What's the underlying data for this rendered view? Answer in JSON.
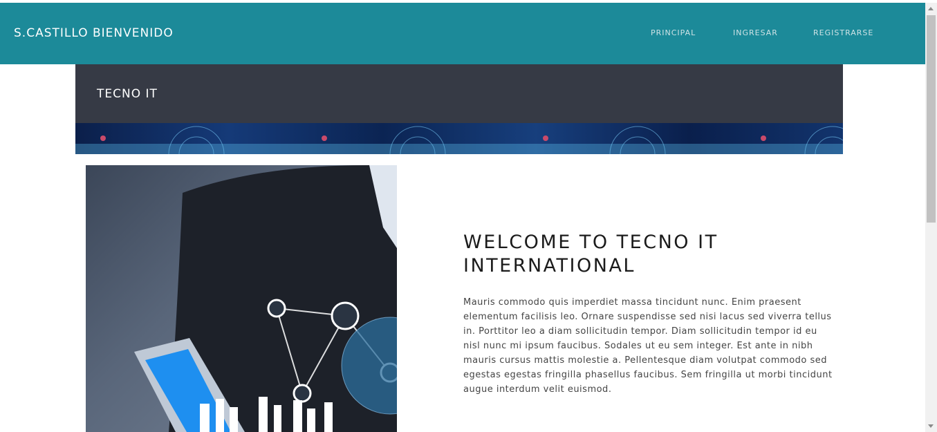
{
  "navbar": {
    "brand": "S.CASTILLO BIENVENIDO",
    "links": [
      "PRINCIPAL",
      "INGRESAR",
      "REGISTRARSE"
    ],
    "background": "#1c8a99"
  },
  "header": {
    "title": "TECNO IT",
    "background": "#363a45"
  },
  "main": {
    "heading": "WELCOME TO TECNO IT INTERNATIONAL",
    "paragraph": "Mauris commodo quis imperdiet massa tincidunt nunc. Enim praesent elementum facilisis leo. Ornare suspendisse sed nisi lacus sed viverra tellus in. Porttitor leo a diam sollicitudin tempor. Diam sollicitudin tempor id eu nisl nunc mi ipsum faucibus. Sodales ut eu sem integer. Est ante in nibh mauris cursus mattis molestie a. Pellentesque diam volutpat commodo sed egestas egestas fringilla phasellus faucibus. Sem fringilla ut morbi tincidunt augue interdum velit euismod."
  }
}
